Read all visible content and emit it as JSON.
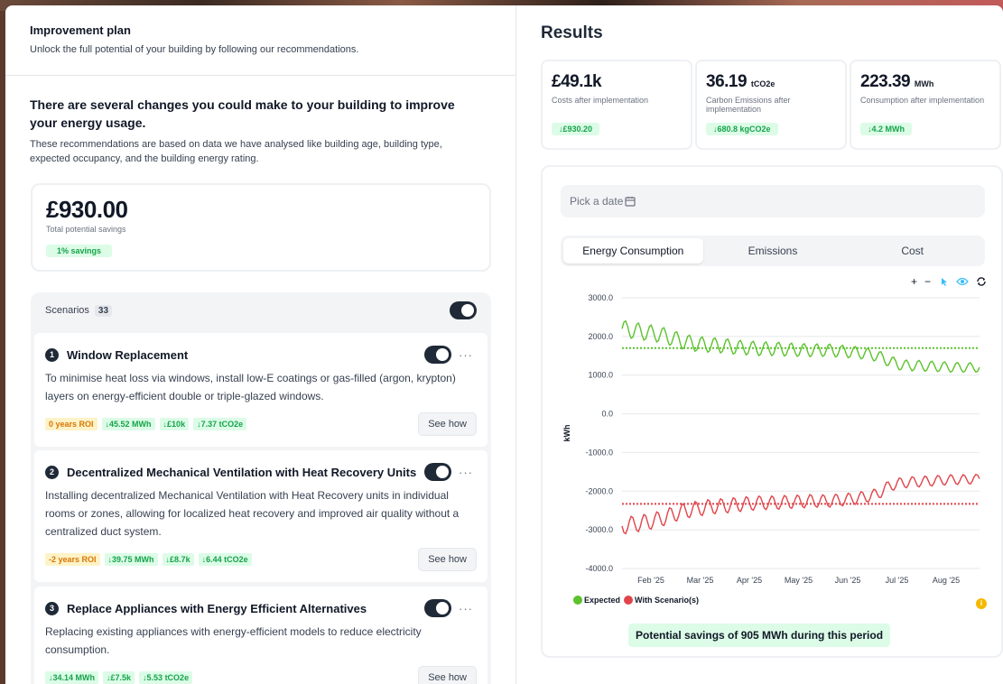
{
  "left": {
    "title": "Improvement plan",
    "subtitle": "Unlock the full potential of your building by following our recommendations.",
    "heading": "There are several changes you could make to your building to improve your energy usage.",
    "paragraph": "These recommendations are based on data we have analysed like building age, building type, expected occupancy, and the building energy rating.",
    "savings": {
      "value": "£930.00",
      "label": "Total potential savings",
      "badge": "1% savings"
    },
    "scenarios": {
      "label": "Scenarios",
      "count": "33",
      "toggle_on": true
    },
    "cards": [
      {
        "num": "1",
        "title": "Window Replacement",
        "desc": "To minimise heat loss via windows, install low-E coatings or gas-filled (argon, krypton) layers on energy-efficient double or triple-glazed windows.",
        "roi": "0 years ROI",
        "tags": [
          "↓45.52 MWh",
          "↓£10k",
          "↓7.37 tCO2e"
        ],
        "button": "See how"
      },
      {
        "num": "2",
        "title": "Decentralized Mechanical Ventilation with Heat Recovery Units",
        "desc": "Installing decentralized Mechanical Ventilation with Heat Recovery units in individual rooms or zones, allowing for localized heat recovery and improved air quality without a centralized duct system.",
        "roi": "-2 years ROI",
        "tags": [
          "↓39.75 MWh",
          "↓£8.7k",
          "↓6.44 tCO2e"
        ],
        "button": "See how"
      },
      {
        "num": "3",
        "title": "Replace Appliances with Energy Efficient Alternatives",
        "desc": "Replacing existing appliances with energy-efficient models to reduce electricity consumption.",
        "roi": "",
        "tags": [
          "↓34.14 MWh",
          "↓£7.5k",
          "↓5.53 tCO2e"
        ],
        "button": "See how"
      }
    ]
  },
  "right": {
    "title": "Results",
    "kpis": [
      {
        "value": "£49.1k",
        "unit": "",
        "label": "Costs after implementation",
        "delta": "↓£930.20"
      },
      {
        "value": "36.19",
        "unit": "tCO2e",
        "label": "Carbon Emissions after implementation",
        "delta": "↓680.8 kgCO2e"
      },
      {
        "value": "223.39",
        "unit": "MWh",
        "label": "Consumption after implementation",
        "delta": "↓4.2 MWh"
      }
    ],
    "date_placeholder": "Pick a date",
    "tabs": [
      "Energy Consumption",
      "Emissions",
      "Cost"
    ],
    "active_tab": 0,
    "tools": [
      "+",
      "−"
    ],
    "summary": "Potential savings of 905 MWh during this period",
    "colors": {
      "expected": "#5cc22d",
      "scenario": "#e0444a"
    }
  },
  "chart_data": {
    "type": "line",
    "ylabel": "kWh",
    "ylim": [
      -4000,
      3000
    ],
    "yticks": [
      "3000.0",
      "2000.0",
      "1000.0",
      "0.0",
      "-1000.0",
      "-2000.0",
      "-3000.0",
      "-4000.0"
    ],
    "x_ticks": [
      "Feb '25",
      "Mar '25",
      "Apr '25",
      "May '25",
      "Jun '25",
      "Jul '25",
      "Aug '25"
    ],
    "legend": [
      "Expected",
      "With Scenario(s)"
    ],
    "expected_avg": 1700,
    "scenario_avg": -2330,
    "series": [
      {
        "name": "Expected",
        "weekly": [
          2200,
          2150,
          2100,
          2050,
          1950,
          1850,
          1800,
          1780,
          1760,
          1720,
          1700,
          1680,
          1680,
          1660,
          1650,
          1640,
          1650,
          1620,
          1600,
          1560,
          1500,
          1350,
          1250,
          1250,
          1230,
          1220,
          1200,
          1200,
          1200
        ]
      },
      {
        "name": "With Scenario(s)",
        "weekly": [
          -2900,
          -2850,
          -2800,
          -2720,
          -2600,
          -2500,
          -2450,
          -2400,
          -2380,
          -2350,
          -2320,
          -2300,
          -2300,
          -2280,
          -2270,
          -2250,
          -2260,
          -2230,
          -2200,
          -2150,
          -2080,
          -1850,
          -1780,
          -1760,
          -1740,
          -1720,
          -1700,
          -1700,
          -1680
        ]
      }
    ]
  }
}
